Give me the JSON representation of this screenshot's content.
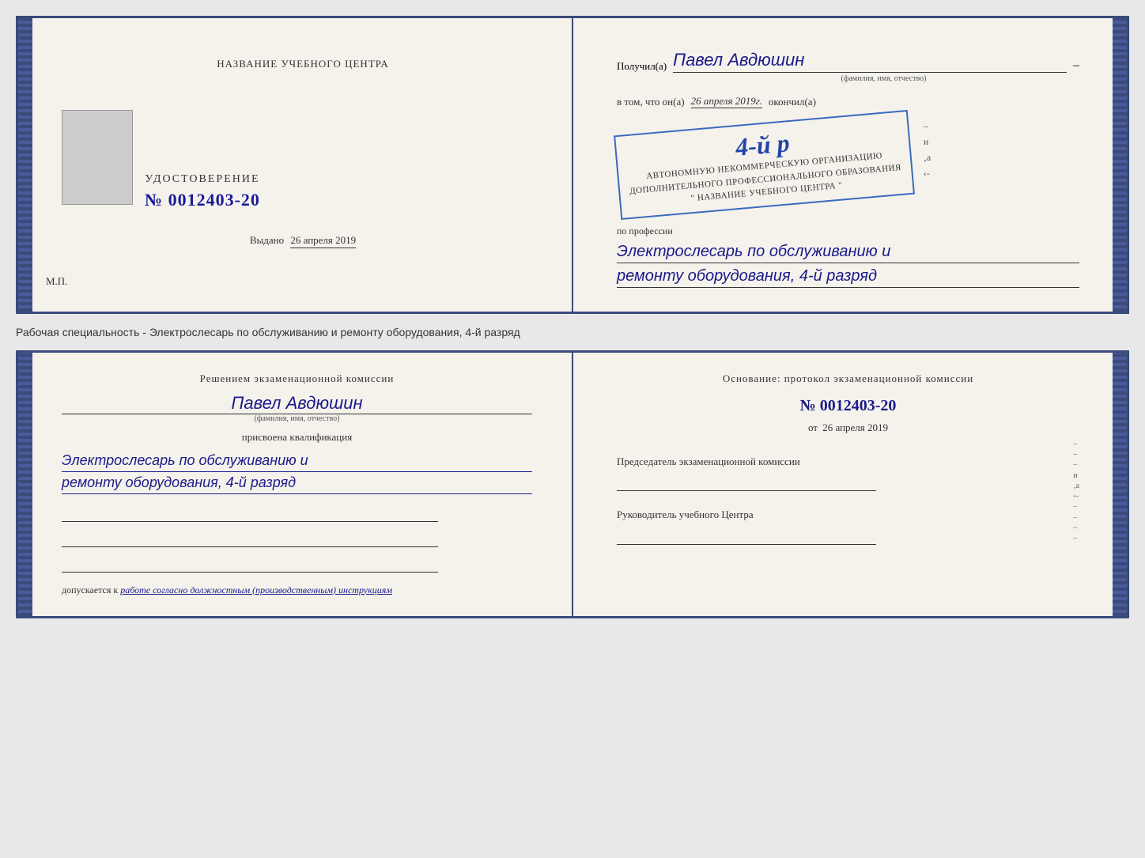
{
  "document": {
    "top_left": {
      "title": "НАЗВАНИЕ УЧЕБНОГО ЦЕНТРА",
      "cert_label": "УДОСТОВЕРЕНИЕ",
      "cert_number": "№ 0012403-20",
      "issued_label": "Выдано",
      "issued_date": "26 апреля 2019",
      "mp_label": "М.П."
    },
    "top_right": {
      "poluchil_label": "Получил(а)",
      "recipient_name": "Павел Авдюшин",
      "fio_hint": "(фамилия, имя, отчество)",
      "vtom_label": "в том, что он(а)",
      "vtom_date": "26 апреля 2019г.",
      "okoncil_label": "окончил(а)",
      "stamp_number": "4-й р",
      "stamp_line1": "АВТОНОМНУЮ НЕКОММЕРЧЕСКУЮ ОРГАНИЗАЦИЮ",
      "stamp_line2": "ДОПОЛНИТЕЛЬНОГО ПРОФЕССИОНАЛЬНОГО ОБРАЗОВАНИЯ",
      "stamp_line3": "\" НАЗВАНИЕ УЧЕБНОГО ЦЕНТРА \"",
      "profession_label": "по профессии",
      "profession_line1": "Электрослесарь по обслуживанию и",
      "profession_line2": "ремонту оборудования, 4-й разряд"
    },
    "separator": "Рабочая специальность - Электрослесарь по обслуживанию и ремонту оборудования, 4-й разряд",
    "bottom_left": {
      "commission_title": "Решением экзаменационной комиссии",
      "person_name": "Павел Авдюшин",
      "fio_hint": "(фамилия, имя, отчество)",
      "prisvoena": "присвоена квалификация",
      "qual_line1": "Электрослесарь по обслуживанию и",
      "qual_line2": "ремонту оборудования, 4-й разряд",
      "dopusk_label": "допускается к",
      "dopusk_value": "работе согласно должностным (производственным) инструкциям"
    },
    "bottom_right": {
      "osnov_label": "Основание: протокол экзаменационной комиссии",
      "protocol_num": "№ 0012403-20",
      "ot_label": "от",
      "ot_date": "26 апреля 2019",
      "chairman_label": "Председатель экзаменационной комиссии",
      "director_label": "Руководитель учебного Центра"
    }
  }
}
